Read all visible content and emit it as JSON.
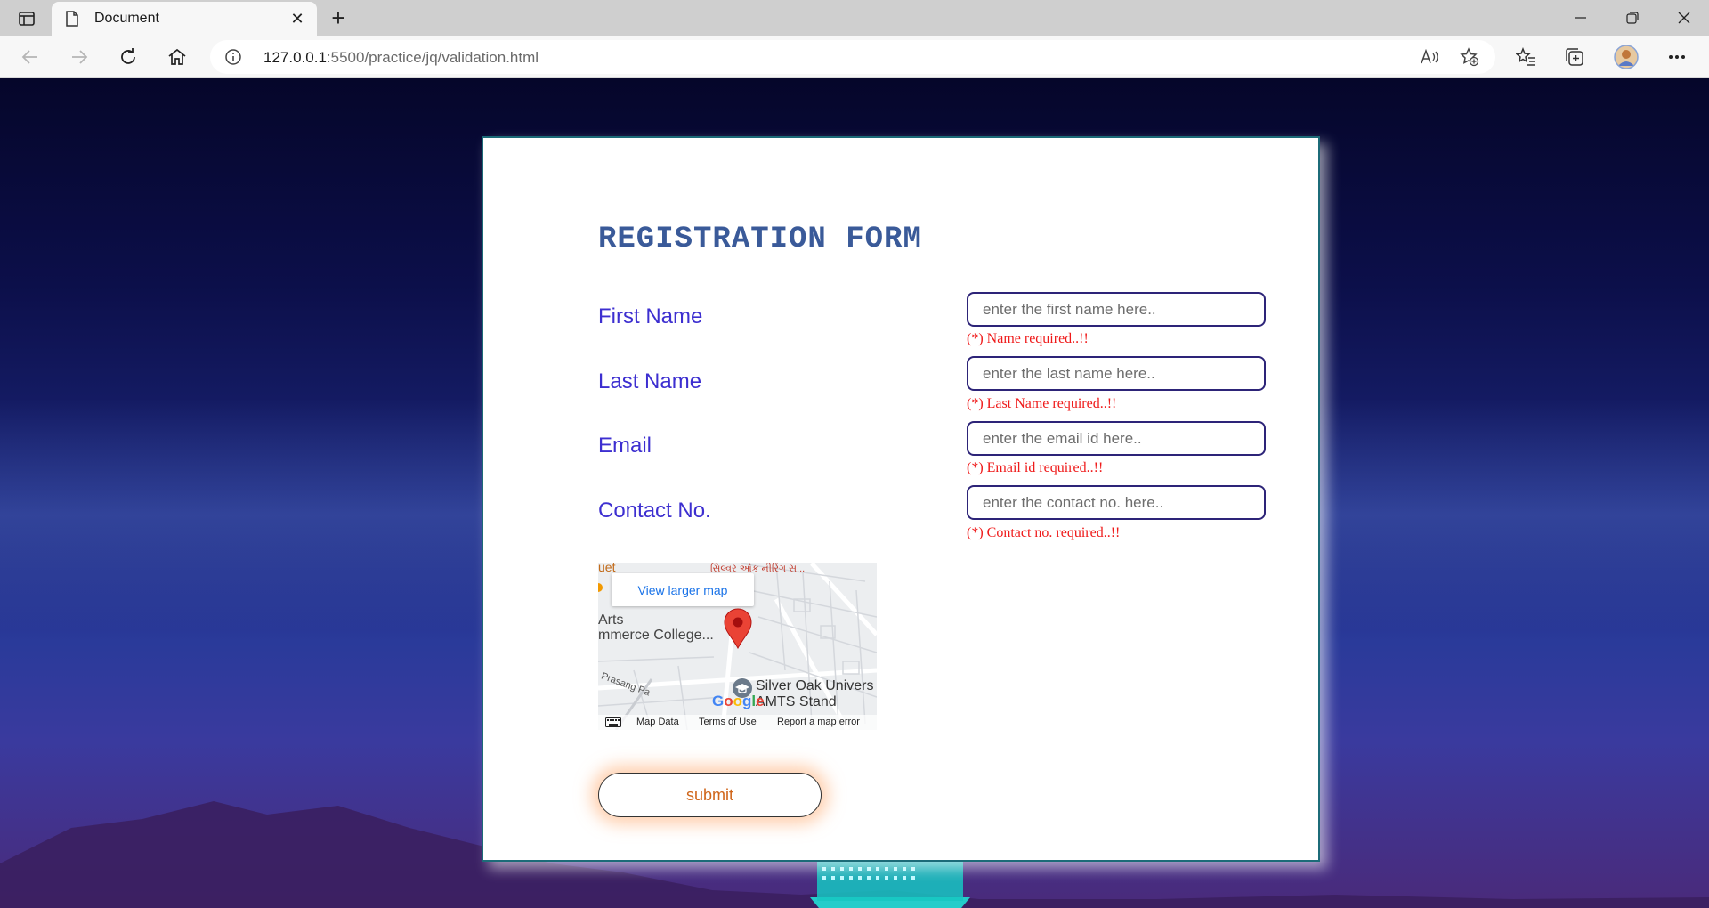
{
  "browser": {
    "tab_title": "Document",
    "url_host": "127.0.0.1",
    "url_rest": ":5500/practice/jq/validation.html"
  },
  "form": {
    "title": "REGISTRATION FORM",
    "fields": [
      {
        "label": "First Name",
        "placeholder": "enter the first name here..",
        "error": "(*) Name required..!!"
      },
      {
        "label": "Last Name",
        "placeholder": "enter the last name here..",
        "error": "(*) Last Name required..!!"
      },
      {
        "label": "Email",
        "placeholder": "enter the email id here..",
        "error": "(*) Email id required..!!"
      },
      {
        "label": "Contact No.",
        "placeholder": "enter the contact no. here..",
        "error": "(*) Contact no. required..!!"
      }
    ],
    "submit_label": "submit"
  },
  "map": {
    "view_larger": "View larger map",
    "labels": {
      "arts": "Arts",
      "college": "mmerce College...",
      "silver_oak": "Silver Oak Univers",
      "amts": "AMTS Stand",
      "prasang": "Prasang Pa",
      "top_left": "uet",
      "guj": "સિલ્વર ઓક નીરિંગ સ..."
    },
    "google": "Google",
    "footer": {
      "data": "Map Data",
      "terms": "Terms of Use",
      "report": "Report a map error"
    }
  },
  "colors": {
    "title": "#3a5a99",
    "label": "#3d2fd0",
    "error": "#ef1a1a",
    "submit_text": "#d0661a",
    "input_border": "#2d2478"
  }
}
